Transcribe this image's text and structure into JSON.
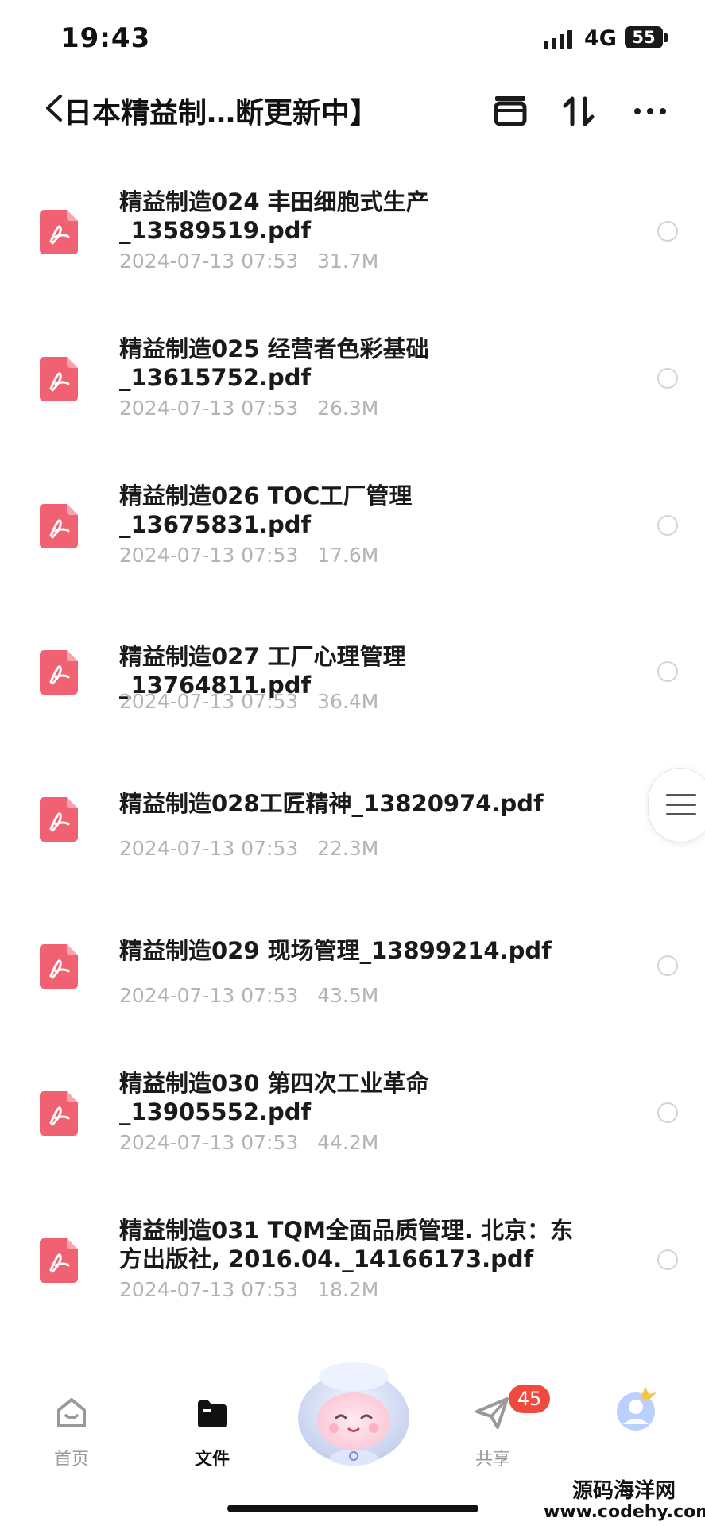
{
  "status_bar": {
    "time": "19:43",
    "network": "4G",
    "battery": "55"
  },
  "nav": {
    "title": "日本精益制…断更新中】"
  },
  "files": [
    {
      "name": "精益制造024 丰田细胞式生产_13589519.pdf",
      "date": "2024-07-13 07:53",
      "size": "31.7M"
    },
    {
      "name": "精益制造025 经营者色彩基础_13615752.pdf",
      "date": "2024-07-13 07:53",
      "size": "26.3M"
    },
    {
      "name": "精益制造026 TOC工厂管理_13675831.pdf",
      "date": "2024-07-13 07:53",
      "size": "17.6M"
    },
    {
      "name": "精益制造027 工厂心理管理_13764811.pdf",
      "date": "2024-07-13 07:53",
      "size": "36.4M"
    },
    {
      "name": "精益制造028工匠精神_13820974.pdf",
      "date": "2024-07-13 07:53",
      "size": "22.3M"
    },
    {
      "name": "精益制造029 现场管理_13899214.pdf",
      "date": "2024-07-13 07:53",
      "size": "43.5M"
    },
    {
      "name": "精益制造030 第四次工业革命_13905552.pdf",
      "date": "2024-07-13 07:53",
      "size": "44.2M"
    },
    {
      "name": "精益制造031 TQM全面品质管理. 北京：东方出版社, 2016.04._14166173.pdf",
      "date": "2024-07-13 07:53",
      "size": "18.2M"
    }
  ],
  "tabs": {
    "home": "首页",
    "files": "文件",
    "share": "共享",
    "share_badge": "45"
  },
  "watermark": {
    "line1": "源码海洋网",
    "line2": "www.codehy.com"
  },
  "colors": {
    "pdf_icon": "#f06272",
    "badge": "#f04a3e",
    "meta_text": "#b3b3b3"
  }
}
